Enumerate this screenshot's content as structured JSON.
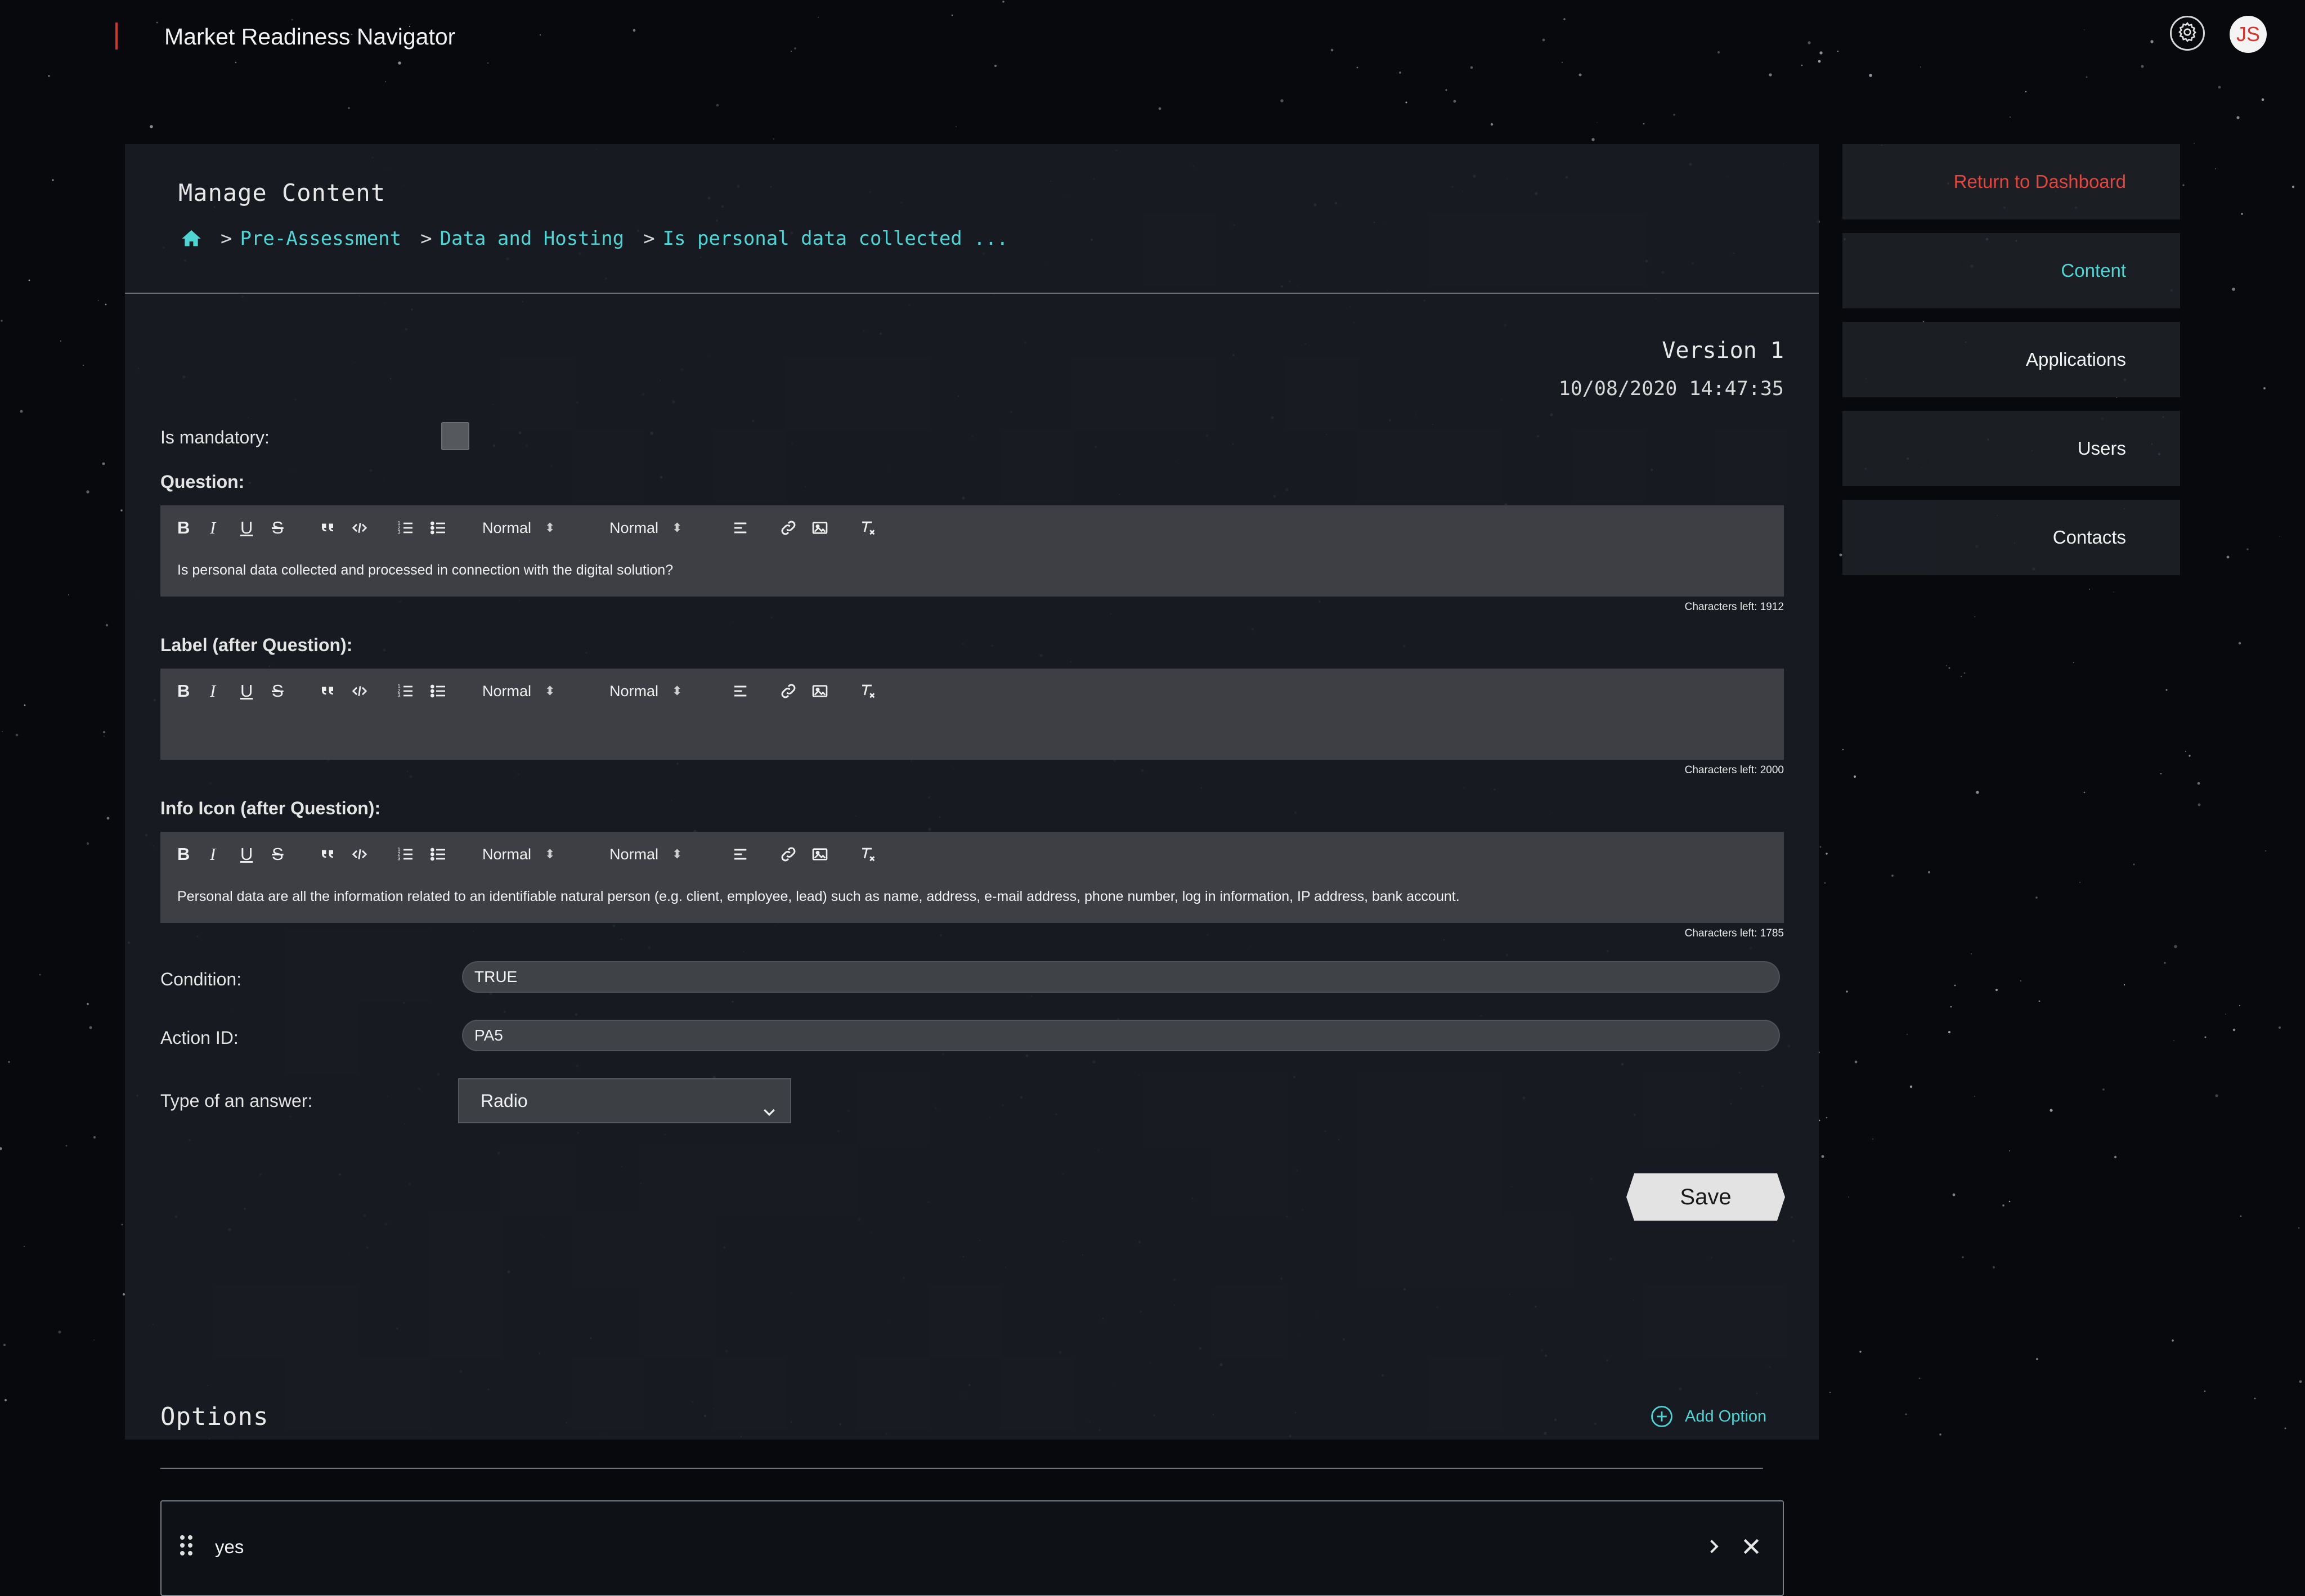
{
  "app": {
    "title": "Market Readiness Navigator",
    "user_initials": "JS"
  },
  "page": {
    "title": "Manage Content",
    "breadcrumb": [
      {
        "label": "Pre-Assessment"
      },
      {
        "label": "Data and Hosting"
      },
      {
        "label": "Is personal data collected ..."
      }
    ],
    "breadcrumb_separator": ">",
    "version_label": "Version 1",
    "timestamp": "10/08/2020 14:47:35"
  },
  "form": {
    "mandatory_label": "Is mandatory:",
    "mandatory_checked": false,
    "toolbar": {
      "bold": "B",
      "italic": "I",
      "underline": "U",
      "strike": "S",
      "size_select": "Normal",
      "header_select": "Normal"
    },
    "question": {
      "label": "Question:",
      "text": "Is personal data collected and processed in connection with the digital solution?",
      "chars_left": "Characters left: 1912"
    },
    "label_after": {
      "label": "Label (after Question):",
      "text": "",
      "chars_left": "Characters left: 2000"
    },
    "info_icon": {
      "label": "Info Icon (after Question):",
      "text": "Personal data are all the information related to an identifiable natural person (e.g. client, employee, lead) such as name, address, e-mail address, phone number, log in information, IP address, bank account.",
      "chars_left": "Characters left: 1785"
    },
    "condition": {
      "label": "Condition:",
      "value": "TRUE"
    },
    "action_id": {
      "label": "Action ID:",
      "value": "PA5"
    },
    "answer_type": {
      "label": "Type of an answer:",
      "value": "Radio"
    },
    "save_label": "Save"
  },
  "options": {
    "title": "Options",
    "add_label": "Add Option",
    "items": [
      {
        "label": "yes"
      }
    ]
  },
  "nav": {
    "items": [
      {
        "label": "Return to Dashboard"
      },
      {
        "label": "Content"
      },
      {
        "label": "Applications"
      },
      {
        "label": "Users"
      },
      {
        "label": "Contacts"
      }
    ]
  },
  "colors": {
    "accent": "#4fd4d4",
    "brand": "#d8342e",
    "panel": "#1a1e24",
    "background": "#07090c"
  }
}
